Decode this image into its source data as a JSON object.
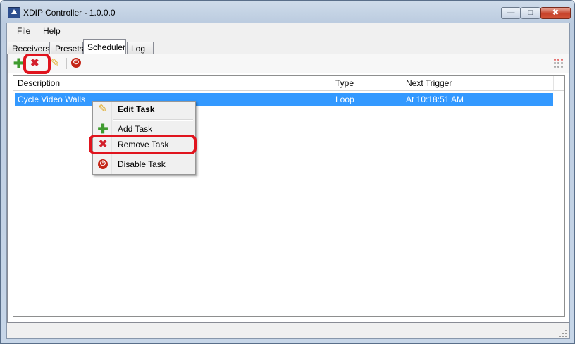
{
  "window": {
    "title": "XDIP Controller - 1.0.0.0"
  },
  "menu": {
    "items": [
      {
        "label": "File"
      },
      {
        "label": "Help"
      }
    ]
  },
  "tabs": [
    {
      "label": "Receivers"
    },
    {
      "label": "Presets"
    },
    {
      "label": "Scheduler"
    },
    {
      "label": "Log"
    }
  ],
  "active_tab": "Scheduler",
  "toolbar": {
    "buttons": [
      {
        "name": "add-task",
        "icon": "plus-icon"
      },
      {
        "name": "remove-task",
        "icon": "x-icon"
      },
      {
        "name": "edit-task",
        "icon": "pencil-icon"
      },
      {
        "name": "disable-task",
        "icon": "power-icon"
      }
    ]
  },
  "grid": {
    "columns": [
      {
        "label": "Description"
      },
      {
        "label": "Type"
      },
      {
        "label": "Next Trigger"
      }
    ],
    "rows": [
      {
        "description": "Cycle Video Walls",
        "type": "Loop",
        "next_trigger": "At 10:18:51 AM",
        "selected": true
      }
    ]
  },
  "context_menu": {
    "items": [
      {
        "label": "Edit Task",
        "icon": "pencil-icon",
        "bold": true
      },
      {
        "label": "Add Task",
        "icon": "plus-icon"
      },
      {
        "label": "Remove Task",
        "icon": "x-icon",
        "highlighted": true
      },
      {
        "label": "Disable Task",
        "icon": "power-icon"
      }
    ]
  },
  "colors": {
    "selection": "#3399ff",
    "annotation": "#e0141e",
    "add": "#3f9b2f",
    "remove": "#d3202c",
    "power": "#c42516"
  }
}
